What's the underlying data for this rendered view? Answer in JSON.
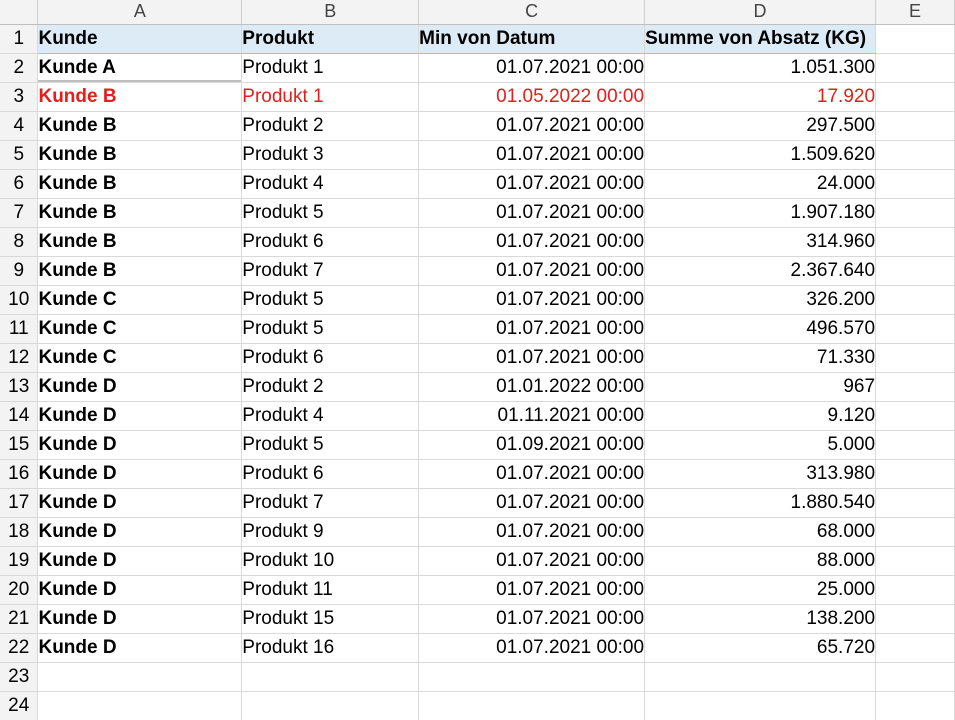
{
  "columns": [
    "A",
    "B",
    "C",
    "D",
    "E"
  ],
  "header": {
    "row": "1",
    "kunde": "Kunde",
    "produkt": "Produkt",
    "datum": "Min von Datum",
    "absatz": "Summe von Absatz (KG)"
  },
  "rows": [
    {
      "row": "2",
      "kunde": "Kunde A",
      "produkt": "Produkt 1",
      "datum": "01.07.2021 00:00",
      "absatz": "1.051.300"
    },
    {
      "row": "3",
      "kunde": "Kunde B",
      "produkt": "Produkt 1",
      "datum": "01.05.2022 00:00",
      "absatz": "17.920"
    },
    {
      "row": "4",
      "kunde": "Kunde B",
      "produkt": "Produkt 2",
      "datum": "01.07.2021 00:00",
      "absatz": "297.500"
    },
    {
      "row": "5",
      "kunde": "Kunde B",
      "produkt": "Produkt 3",
      "datum": "01.07.2021 00:00",
      "absatz": "1.509.620"
    },
    {
      "row": "6",
      "kunde": "Kunde B",
      "produkt": "Produkt 4",
      "datum": "01.07.2021 00:00",
      "absatz": "24.000"
    },
    {
      "row": "7",
      "kunde": "Kunde B",
      "produkt": "Produkt 5",
      "datum": "01.07.2021 00:00",
      "absatz": "1.907.180"
    },
    {
      "row": "8",
      "kunde": "Kunde B",
      "produkt": "Produkt 6",
      "datum": "01.07.2021 00:00",
      "absatz": "314.960"
    },
    {
      "row": "9",
      "kunde": "Kunde B",
      "produkt": "Produkt 7",
      "datum": "01.07.2021 00:00",
      "absatz": "2.367.640"
    },
    {
      "row": "10",
      "kunde": "Kunde C",
      "produkt": "Produkt 5",
      "datum": "01.07.2021 00:00",
      "absatz": "326.200"
    },
    {
      "row": "11",
      "kunde": "Kunde C",
      "produkt": "Produkt 5",
      "datum": "01.07.2021 00:00",
      "absatz": "496.570"
    },
    {
      "row": "12",
      "kunde": "Kunde C",
      "produkt": "Produkt 6",
      "datum": "01.07.2021 00:00",
      "absatz": "71.330"
    },
    {
      "row": "13",
      "kunde": "Kunde D",
      "produkt": "Produkt 2",
      "datum": "01.01.2022 00:00",
      "absatz": "967"
    },
    {
      "row": "14",
      "kunde": "Kunde D",
      "produkt": "Produkt 4",
      "datum": "01.11.2021 00:00",
      "absatz": "9.120"
    },
    {
      "row": "15",
      "kunde": "Kunde D",
      "produkt": "Produkt 5",
      "datum": "01.09.2021 00:00",
      "absatz": "5.000"
    },
    {
      "row": "16",
      "kunde": "Kunde D",
      "produkt": "Produkt 6",
      "datum": "01.07.2021 00:00",
      "absatz": "313.980"
    },
    {
      "row": "17",
      "kunde": "Kunde D",
      "produkt": "Produkt 7",
      "datum": "01.07.2021 00:00",
      "absatz": "1.880.540"
    },
    {
      "row": "18",
      "kunde": "Kunde D",
      "produkt": "Produkt 9",
      "datum": "01.07.2021 00:00",
      "absatz": "68.000"
    },
    {
      "row": "19",
      "kunde": "Kunde D",
      "produkt": "Produkt 10",
      "datum": "01.07.2021 00:00",
      "absatz": "88.000"
    },
    {
      "row": "20",
      "kunde": "Kunde D",
      "produkt": "Produkt 11",
      "datum": "01.07.2021 00:00",
      "absatz": "25.000"
    },
    {
      "row": "21",
      "kunde": "Kunde D",
      "produkt": "Produkt 15",
      "datum": "01.07.2021 00:00",
      "absatz": "138.200"
    },
    {
      "row": "22",
      "kunde": "Kunde D",
      "produkt": "Produkt 16",
      "datum": "01.07.2021 00:00",
      "absatz": "65.720"
    }
  ],
  "empty_rows": [
    "23",
    "24"
  ],
  "colors": {
    "highlight_text": "#e0201c",
    "header_fill": "#ddebf7",
    "gridline": "#d9d9d9"
  }
}
